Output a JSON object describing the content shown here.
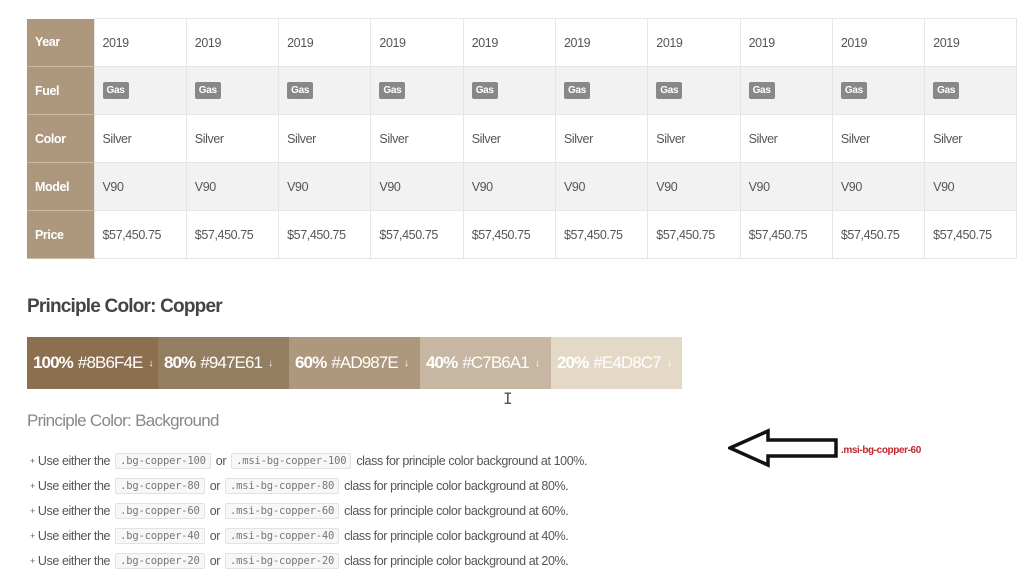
{
  "table": {
    "rows": [
      {
        "label": "Year",
        "cells": [
          "2019",
          "2019",
          "2019",
          "2019",
          "2019",
          "2019",
          "2019",
          "2019",
          "2019",
          "2019"
        ]
      },
      {
        "label": "Fuel",
        "cells": [
          "Gas",
          "Gas",
          "Gas",
          "Gas",
          "Gas",
          "Gas",
          "Gas",
          "Gas",
          "Gas",
          "Gas"
        ]
      },
      {
        "label": "Color",
        "cells": [
          "Silver",
          "Silver",
          "Silver",
          "Silver",
          "Silver",
          "Silver",
          "Silver",
          "Silver",
          "Silver",
          "Silver"
        ]
      },
      {
        "label": "Model",
        "cells": [
          "V90",
          "V90",
          "V90",
          "V90",
          "V90",
          "V90",
          "V90",
          "V90",
          "V90",
          "V90"
        ]
      },
      {
        "label": "Price",
        "cells": [
          "$57,450.75",
          "$57,450.75",
          "$57,450.75",
          "$57,450.75",
          "$57,450.75",
          "$57,450.75",
          "$57,450.75",
          "$57,450.75",
          "$57,450.75",
          "$57,450.75"
        ]
      }
    ]
  },
  "palette": {
    "title": "Principle Color: Copper",
    "swatches": [
      {
        "pct": "100%",
        "hex": "#8B6F4E",
        "arrow": "↓",
        "color": "#8b6f4e"
      },
      {
        "pct": "80%",
        "hex": "#947E61",
        "arrow": "↓",
        "color": "#947e61"
      },
      {
        "pct": "60%",
        "hex": "#AD987E",
        "arrow": "↓",
        "color": "#ad987e"
      },
      {
        "pct": "40%",
        "hex": "#C7B6A1",
        "arrow": "↓",
        "color": "#c7b6a1"
      },
      {
        "pct": "20%",
        "hex": "#E4D8C7",
        "arrow": "↓",
        "color": "#e4d8c7"
      }
    ]
  },
  "background_section": {
    "heading": "Principle Color: Background",
    "items": [
      {
        "prefix": "Use either the",
        "code1": ".bg-copper-100",
        "or": "or",
        "code2": ".msi-bg-copper-100",
        "suffix": "class for principle color background at 100%."
      },
      {
        "prefix": "Use either the",
        "code1": ".bg-copper-80",
        "or": "or",
        "code2": ".msi-bg-copper-80",
        "suffix": "class for principle color background at 80%."
      },
      {
        "prefix": "Use either the",
        "code1": ".bg-copper-60",
        "or": "or",
        "code2": ".msi-bg-copper-60",
        "suffix": "class for principle color background at 60%."
      },
      {
        "prefix": "Use either the",
        "code1": ".bg-copper-40",
        "or": "or",
        "code2": ".msi-bg-copper-40",
        "suffix": "class for principle color background at 40%."
      },
      {
        "prefix": "Use either the",
        "code1": ".bg-copper-20",
        "or": "or",
        "code2": ".msi-bg-copper-20",
        "suffix": "class for principle color background at 20%."
      }
    ]
  },
  "annotation": {
    "label": ".msi-bg-copper-60",
    "color": "#c0262d"
  },
  "icons": {
    "bullet": "+",
    "cursor": "I"
  }
}
